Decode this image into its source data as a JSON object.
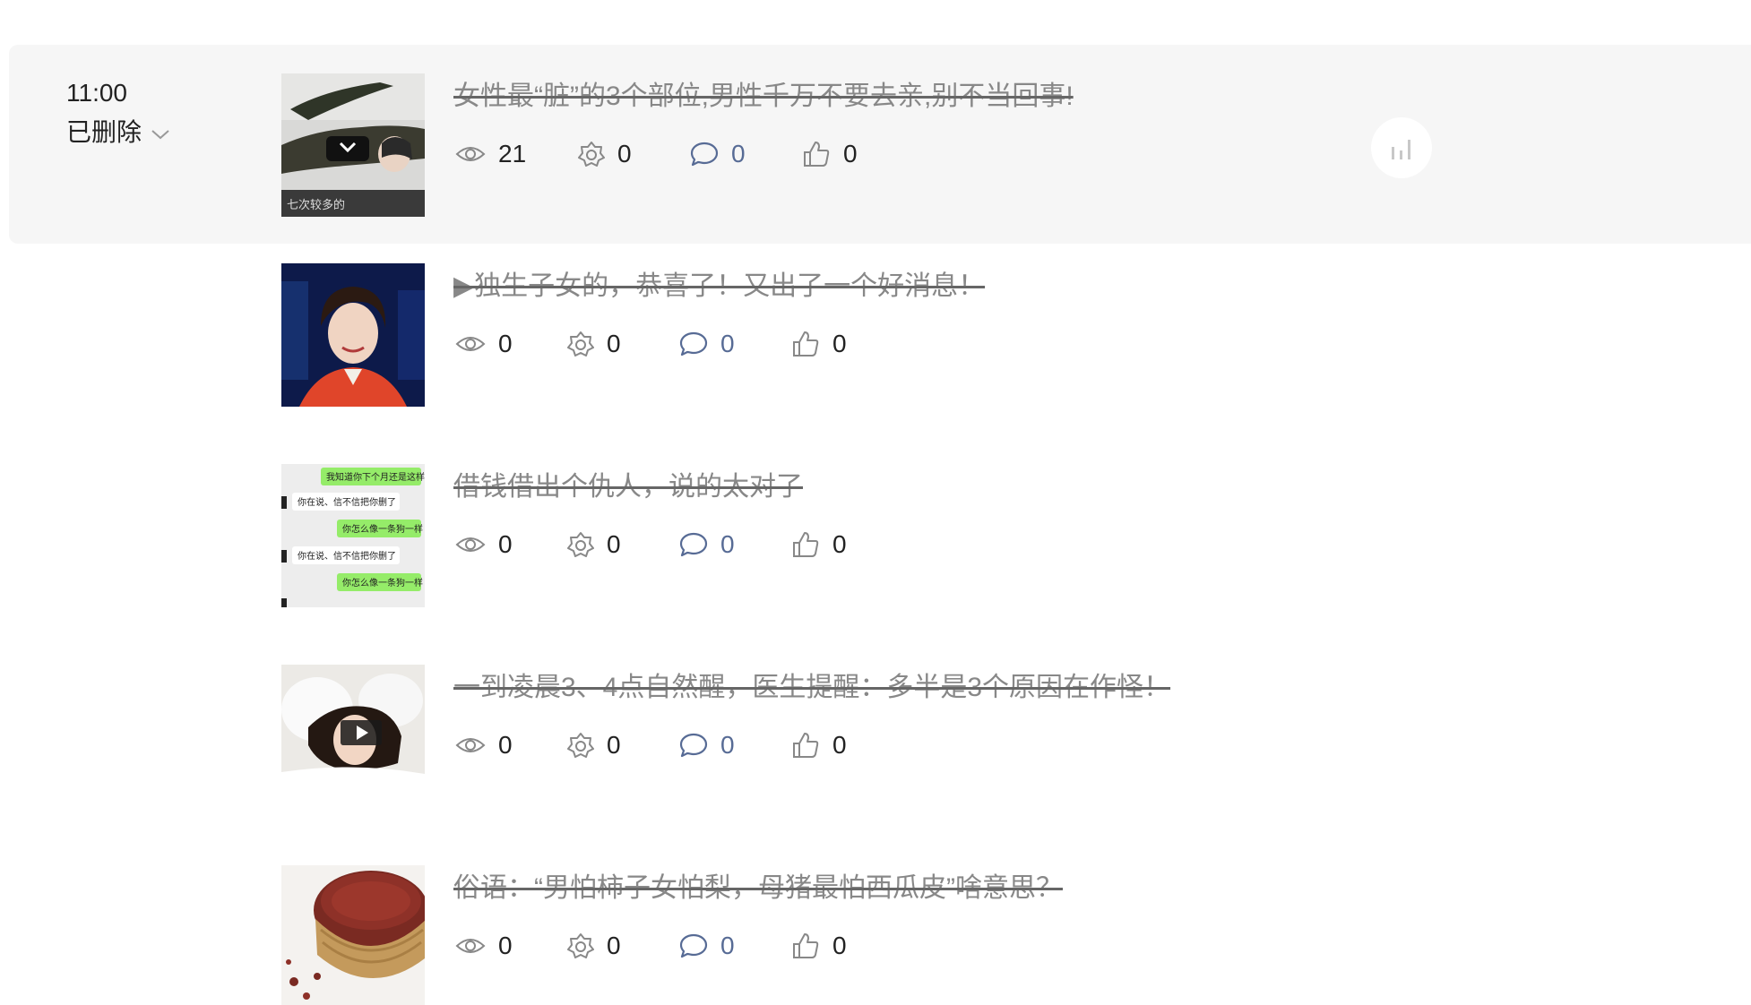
{
  "group": {
    "time": "11:00",
    "status": "已删除",
    "icons": {
      "status_dropdown": "chevron-down-icon",
      "stats": "bar-chart-icon"
    }
  },
  "icons": {
    "views": "eye-icon",
    "shares": "share-icon",
    "comments": "comment-icon",
    "likes": "thumbs-up-icon"
  },
  "colors": {
    "group_bg": "#f6f6f6",
    "comment_count": "#576b95",
    "title_deleted": "#888888"
  },
  "articles": [
    {
      "title": "女性最“脏”的3个部位,男性千万不要去亲,别不当回事!",
      "views": "21",
      "shares": "0",
      "comments": "0",
      "likes": "0",
      "thumb_caption": "七次较多的"
    },
    {
      "title": "▶独生子女的，恭喜了！又出了一个好消息！",
      "views": "0",
      "shares": "0",
      "comments": "0",
      "likes": "0"
    },
    {
      "title": "借钱借出个仇人，说的太对了",
      "views": "0",
      "shares": "0",
      "comments": "0",
      "likes": "0",
      "thumb_chat": [
        "我知道你下个月还是这样",
        "你在说、信不信把你删了",
        "你怎么像一条狗一样",
        "你在说、信不信把你删了",
        "你怎么像一条狗一样"
      ]
    },
    {
      "title": "一到凌晨3、4点自然醒，医生提醒：多半是3个原因在作怪！",
      "views": "0",
      "shares": "0",
      "comments": "0",
      "likes": "0"
    },
    {
      "title": "俗语：“男怕柿子女怕梨，母猪最怕西瓜皮”啥意思？",
      "views": "0",
      "shares": "0",
      "comments": "0",
      "likes": "0"
    }
  ]
}
